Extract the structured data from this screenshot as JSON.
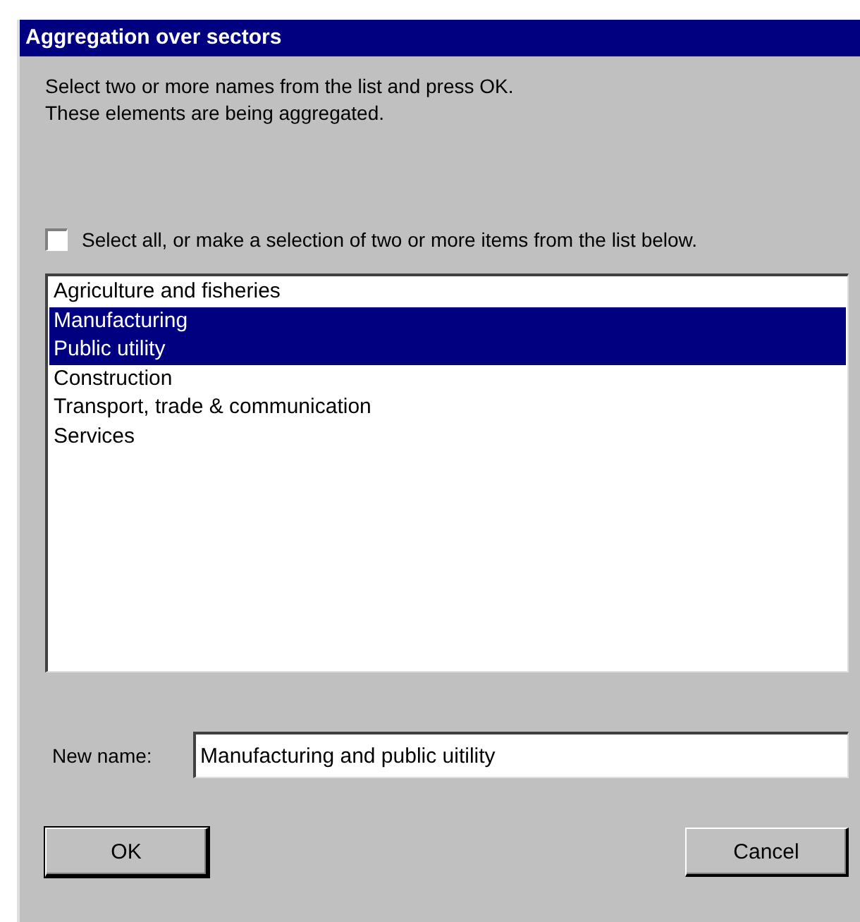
{
  "window": {
    "title": "Aggregation over sectors"
  },
  "instructions": [
    "Select two or more names from the list and press OK.",
    "These elements are being aggregated."
  ],
  "select_all": {
    "label": "Select all, or make a selection of two or more items from the list below.",
    "checked": false
  },
  "list": [
    {
      "label": "Agriculture and fisheries",
      "selected": false
    },
    {
      "label": "Manufacturing",
      "selected": true
    },
    {
      "label": "Public utility",
      "selected": true
    },
    {
      "label": "Construction",
      "selected": false
    },
    {
      "label": "Transport, trade & communication",
      "selected": false
    },
    {
      "label": "Services",
      "selected": false
    }
  ],
  "new_name": {
    "label": "New name:",
    "value": "Manufacturing and public uitility"
  },
  "buttons": [
    "OK",
    "Cancel"
  ]
}
